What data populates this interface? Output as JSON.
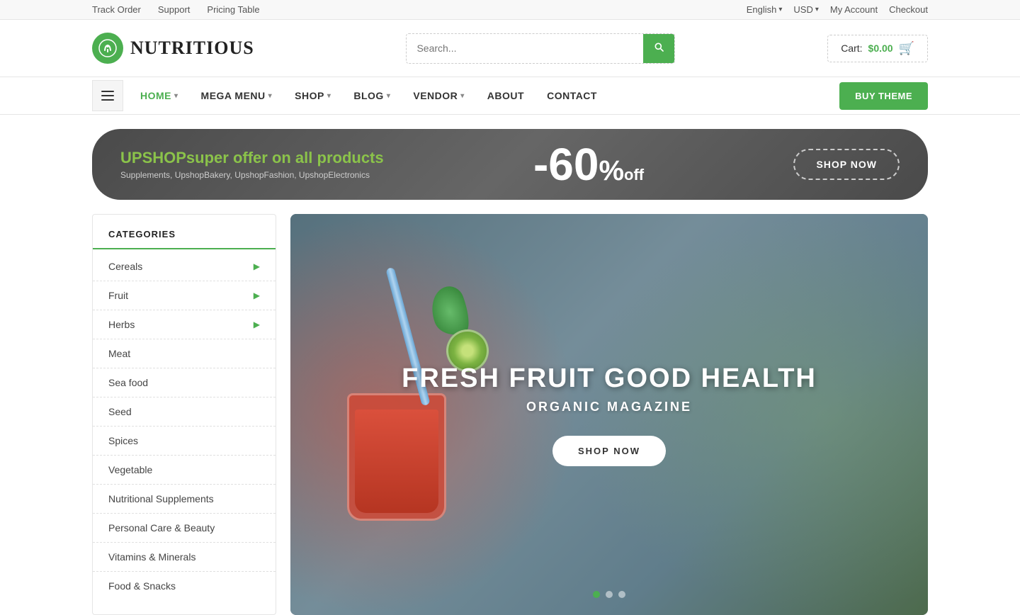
{
  "topbar": {
    "left": [
      {
        "label": "Track Order",
        "href": "#"
      },
      {
        "label": "Support",
        "href": "#"
      },
      {
        "label": "Pricing Table",
        "href": "#"
      }
    ],
    "right": {
      "language": "English",
      "currency": "USD",
      "account": "My Account",
      "checkout": "Checkout"
    }
  },
  "header": {
    "logo_text": "NUTRITIOUS",
    "logo_icon": "🥤",
    "search_placeholder": "Search...",
    "cart_label": "Cart:",
    "cart_price": "$0.00"
  },
  "nav": {
    "items": [
      {
        "label": "HOME",
        "active": true,
        "has_dropdown": true
      },
      {
        "label": "MEGA MENU",
        "active": false,
        "has_dropdown": true
      },
      {
        "label": "SHOP",
        "active": false,
        "has_dropdown": true
      },
      {
        "label": "BLOG",
        "active": false,
        "has_dropdown": true
      },
      {
        "label": "VENDOR",
        "active": false,
        "has_dropdown": true
      },
      {
        "label": "ABOUT",
        "active": false,
        "has_dropdown": false
      },
      {
        "label": "CONTACT",
        "active": false,
        "has_dropdown": false
      }
    ],
    "buy_theme_label": "BUY THEME"
  },
  "promo_banner": {
    "brand_prefix": "UP",
    "brand_highlight": "SHOP",
    "brand_suffix": "super offer on all products",
    "subtitle": "Supplements, UpshopBakery, UpshopFashion, UpshopElectronics",
    "discount": "-60",
    "percent_symbol": "%",
    "off_label": "off",
    "button_label": "SHOP NOW"
  },
  "sidebar": {
    "title": "CATEGORIES",
    "items": [
      {
        "label": "Cereals",
        "has_arrow": true
      },
      {
        "label": "Fruit",
        "has_arrow": true
      },
      {
        "label": "Herbs",
        "has_arrow": true
      },
      {
        "label": "Meat",
        "has_arrow": false
      },
      {
        "label": "Sea food",
        "has_arrow": false
      },
      {
        "label": "Seed",
        "has_arrow": false
      },
      {
        "label": "Spices",
        "has_arrow": false
      },
      {
        "label": "Vegetable",
        "has_arrow": false
      },
      {
        "label": "Nutritional Supplements",
        "has_arrow": false
      },
      {
        "label": "Personal Care & Beauty",
        "has_arrow": false
      },
      {
        "label": "Vitamins & Minerals",
        "has_arrow": false
      },
      {
        "label": "Food & Snacks",
        "has_arrow": false
      }
    ]
  },
  "hero": {
    "title": "FRESH FRUIT GOOD HEALTH",
    "subtitle": "ORGANIC MAGAZINE",
    "button_label": "SHOP NOW",
    "dots": [
      {
        "active": true
      },
      {
        "active": false
      },
      {
        "active": false
      }
    ]
  }
}
